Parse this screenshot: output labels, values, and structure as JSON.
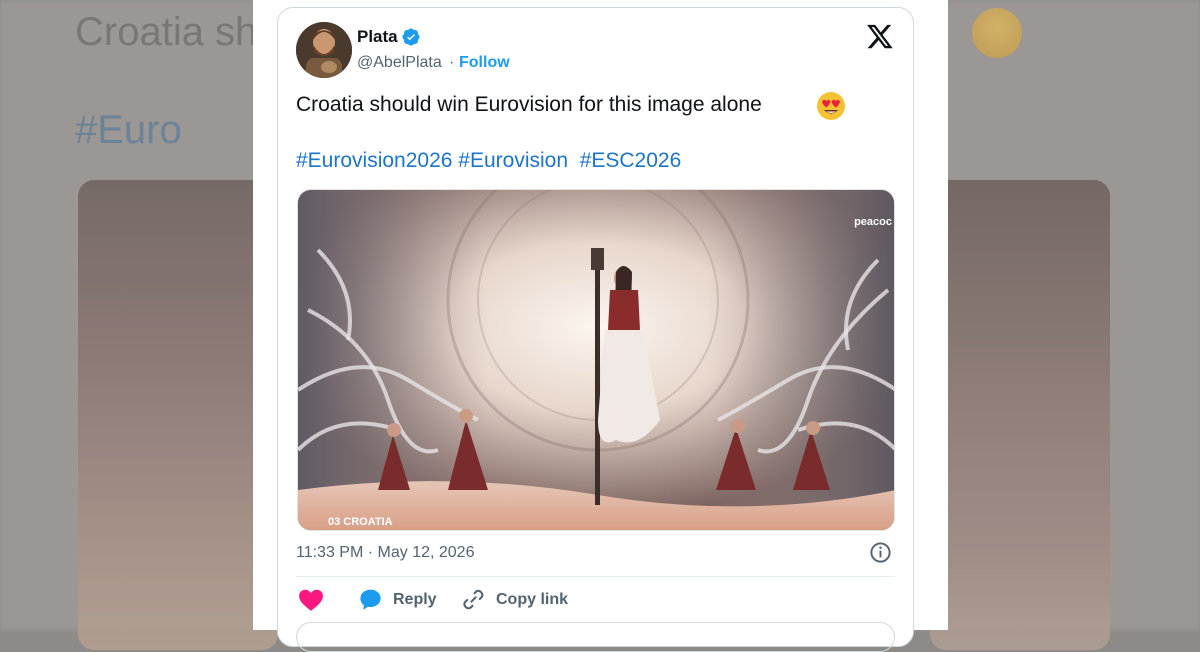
{
  "author": {
    "name": "Plata",
    "handle": "@AbelPlata",
    "separator": "·",
    "follow_label": "Follow"
  },
  "tweet": {
    "text": "Croatia should win Eurovision for this image alone",
    "emoji": "heart-eyes-emoji",
    "hashtags": [
      "#Eurovision2026",
      "#Eurovision",
      "#ESC2026"
    ],
    "timestamp": "11:33 PM · May 12, 2026"
  },
  "media": {
    "watermark": "peacoc",
    "caption": "03 CROATIA"
  },
  "actions": {
    "reply_label": "Reply",
    "copy_link_label": "Copy link"
  },
  "backdrop": {
    "text": "Croatia sh",
    "tag": "#Euro"
  },
  "colors": {
    "link_blue": "#1d9bf0",
    "hashtag_blue": "#1d75c9",
    "heart_pink": "#f91880",
    "text_primary": "#0f1419",
    "text_secondary": "#536471"
  }
}
